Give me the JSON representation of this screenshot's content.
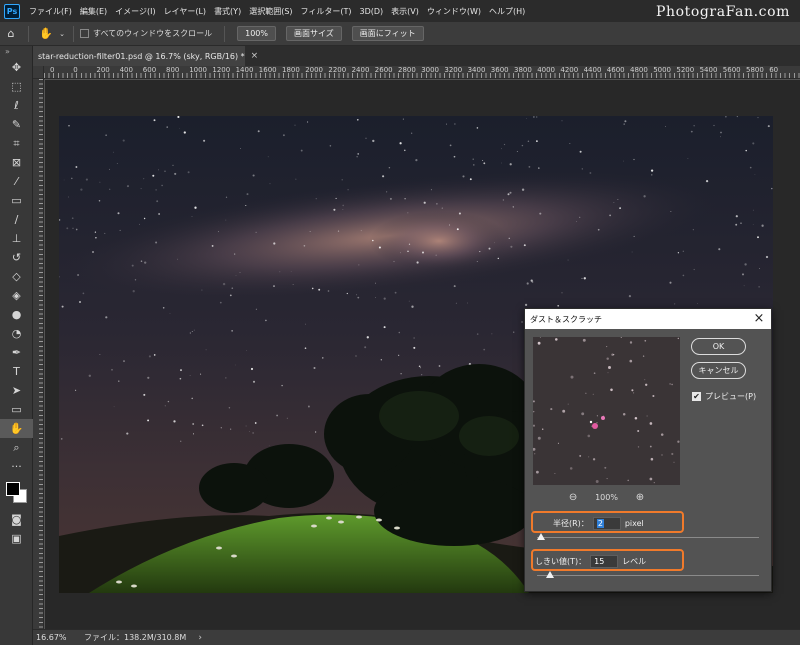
{
  "app": {
    "logo": "Ps",
    "menu": [
      "ファイル(F)",
      "編集(E)",
      "イメージ(I)",
      "レイヤー(L)",
      "書式(Y)",
      "選択範囲(S)",
      "フィルター(T)",
      "3D(D)",
      "表示(V)",
      "ウィンドウ(W)",
      "ヘルプ(H)"
    ],
    "site_logo": "PhotograFan.com"
  },
  "options": {
    "scroll_all_label": "すべてのウィンドウをスクロール",
    "zoom_value": "100%",
    "fit_screen_label": "画面サイズ",
    "fill_screen_label": "画面にフィット"
  },
  "document": {
    "tab_title": "star-reduction-filter01.psd @ 16.7% (sky, RGB/16) *",
    "close_glyph": "×"
  },
  "ruler": {
    "labels": [
      "0",
      "0",
      "200",
      "400",
      "600",
      "800",
      "1000",
      "1200",
      "1400",
      "1600",
      "1800",
      "2000",
      "2200",
      "2400",
      "2600",
      "2800",
      "3000",
      "3200",
      "3400",
      "3600",
      "3800",
      "4000",
      "4200",
      "4400",
      "4600",
      "4800",
      "5000",
      "5200",
      "5400",
      "5600",
      "5800",
      "60"
    ]
  },
  "status": {
    "zoom": "16.67%",
    "file_size": "ファイル：138.2M/310.8M",
    "arrow": "›"
  },
  "tools": [
    "move-icon",
    "marquee-icon",
    "lasso-icon",
    "quick-select-icon",
    "crop-icon",
    "frame-icon",
    "eyedropper-icon",
    "healing-brush-icon",
    "brush-icon",
    "stamp-icon",
    "history-brush-icon",
    "eraser-icon",
    "paint-bucket-icon",
    "blur-icon",
    "dodge-icon",
    "pen-icon",
    "type-icon",
    "path-select-icon",
    "rectangle-icon",
    "hand-icon",
    "zoom-icon",
    "more-icon"
  ],
  "dialog": {
    "title": "ダスト＆スクラッチ",
    "close": "×",
    "ok": "OK",
    "cancel": "キャンセル",
    "preview_label": "プレビュー(P)",
    "preview_checked": true,
    "zoom": "100%",
    "radius_label": "半径(R)：",
    "radius_value": "2",
    "radius_unit": "pixel",
    "threshold_label": "しきい値(T)：",
    "threshold_value": "15",
    "threshold_unit": "レベル",
    "radius_slider_fraction": 0.02,
    "threshold_slider_fraction": 0.06
  },
  "colors": {
    "highlight": "#f07a2b",
    "ps_blue": "#31a8ff"
  }
}
